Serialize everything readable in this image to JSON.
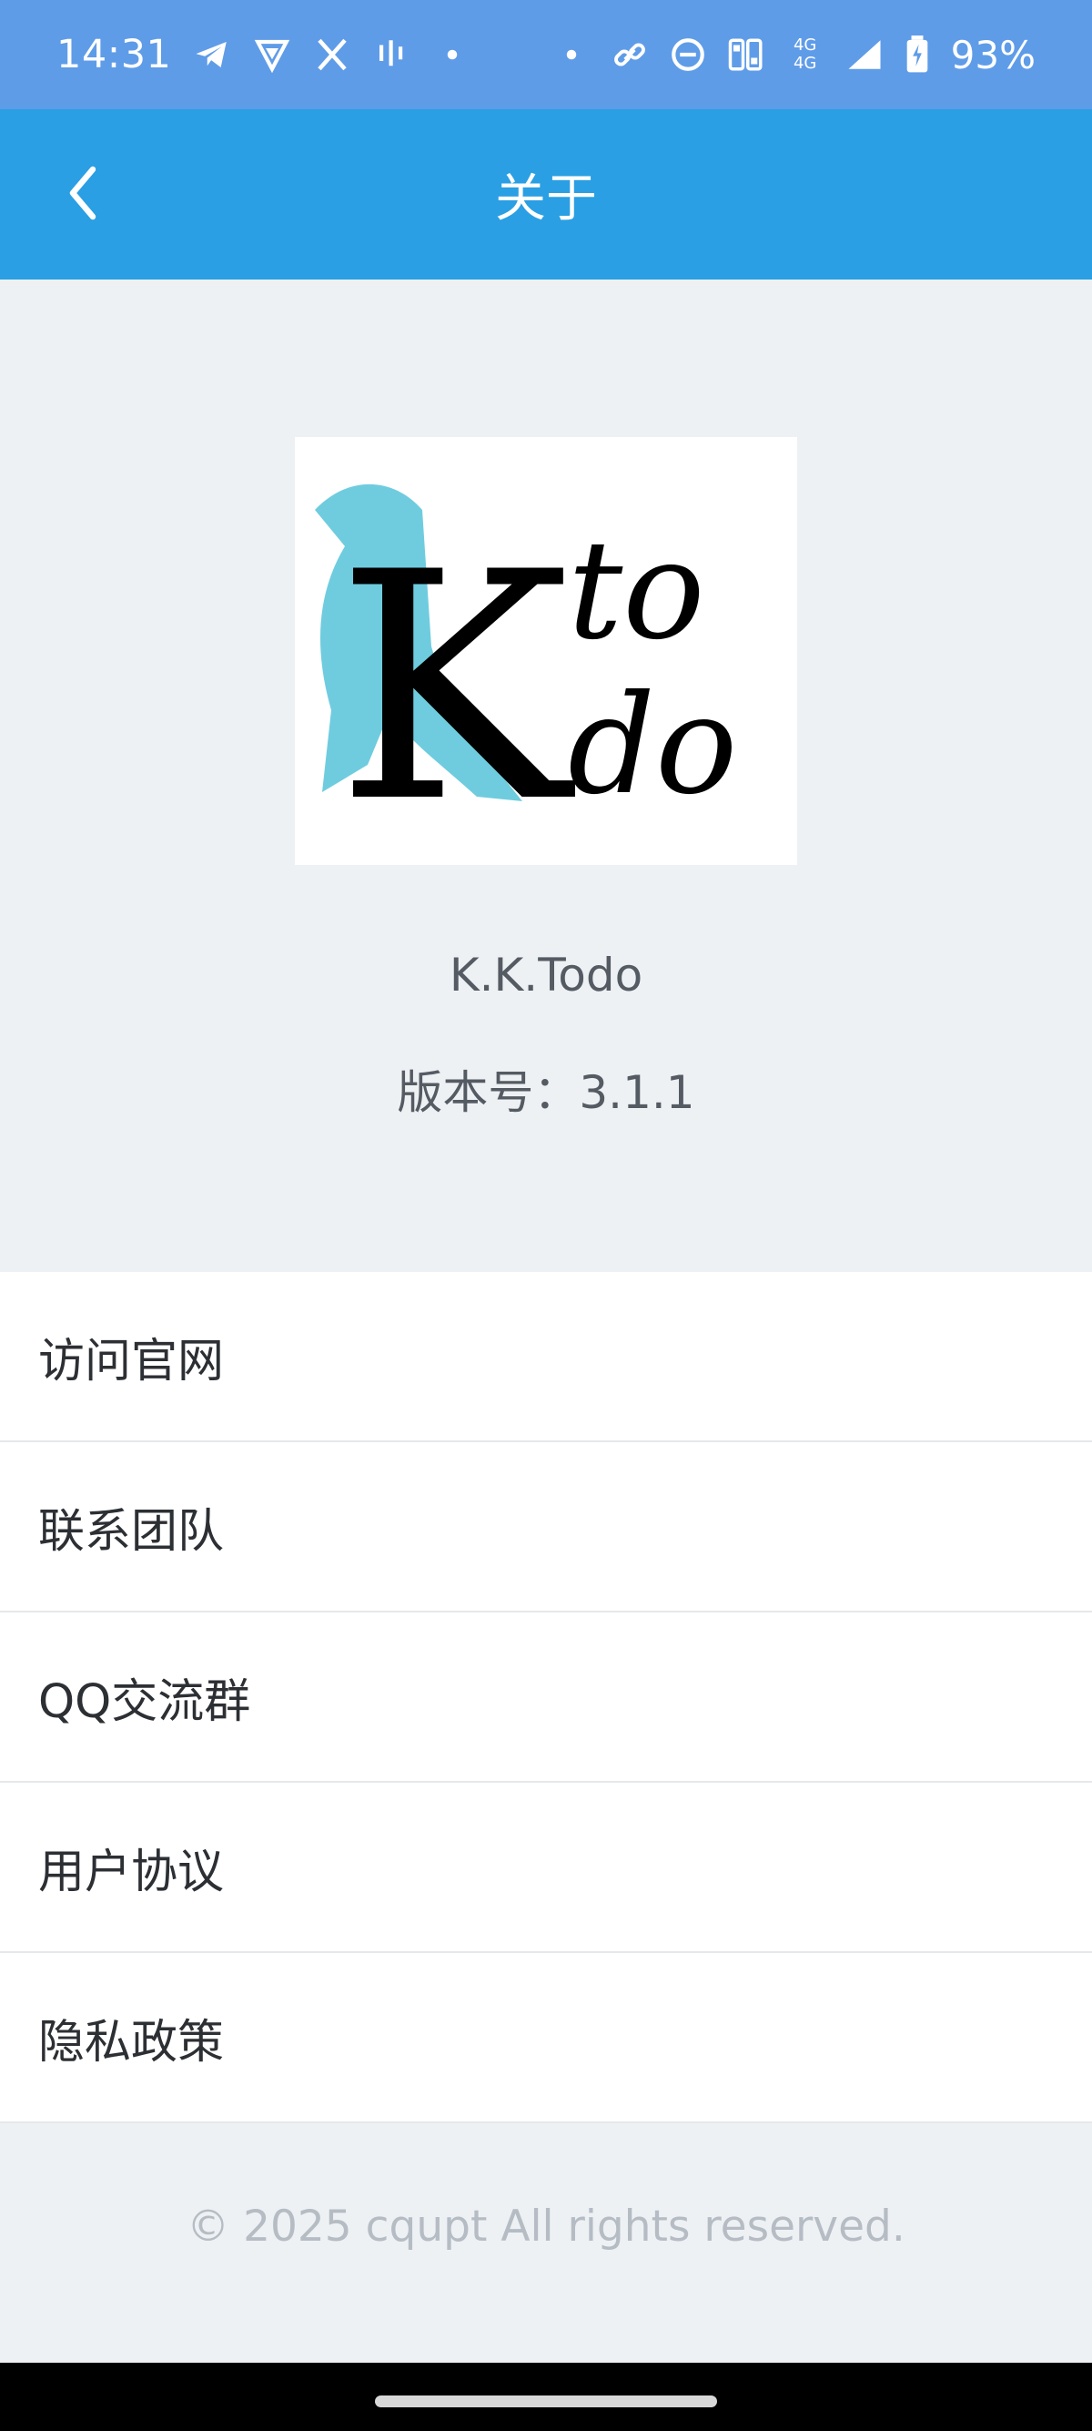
{
  "status_bar": {
    "time": "14:31",
    "battery": "93%",
    "left_icons": [
      "telegram-icon",
      "vpn-shield-icon",
      "x-icon",
      "voice-bars-icon",
      "dot-icon"
    ],
    "right_icons": [
      "dot-icon",
      "link-icon",
      "dnd-icon",
      "sim-cards-icon",
      "signal-icon",
      "battery-charging-icon"
    ],
    "network_labels": [
      "4G",
      "4G"
    ]
  },
  "app_bar": {
    "title": "关于",
    "back_icon": "chevron-left-icon"
  },
  "about": {
    "logo_letter": "K",
    "logo_word_top": "to",
    "logo_word_bottom": "do",
    "app_name": "K.K.Todo",
    "version": "版本号：3.1.1"
  },
  "menu": {
    "items": [
      {
        "label": "访问官网"
      },
      {
        "label": "联系团队"
      },
      {
        "label": "QQ交流群"
      },
      {
        "label": "用户协议"
      },
      {
        "label": "隐私政策"
      }
    ]
  },
  "footer": {
    "copyright": "© 2025 cqupt All rights reserved."
  },
  "colors": {
    "status_bar": "#5f9ce8",
    "app_bar": "#2a9fe3",
    "background": "#eef1f4",
    "logo_accent": "#5fc6dc"
  }
}
